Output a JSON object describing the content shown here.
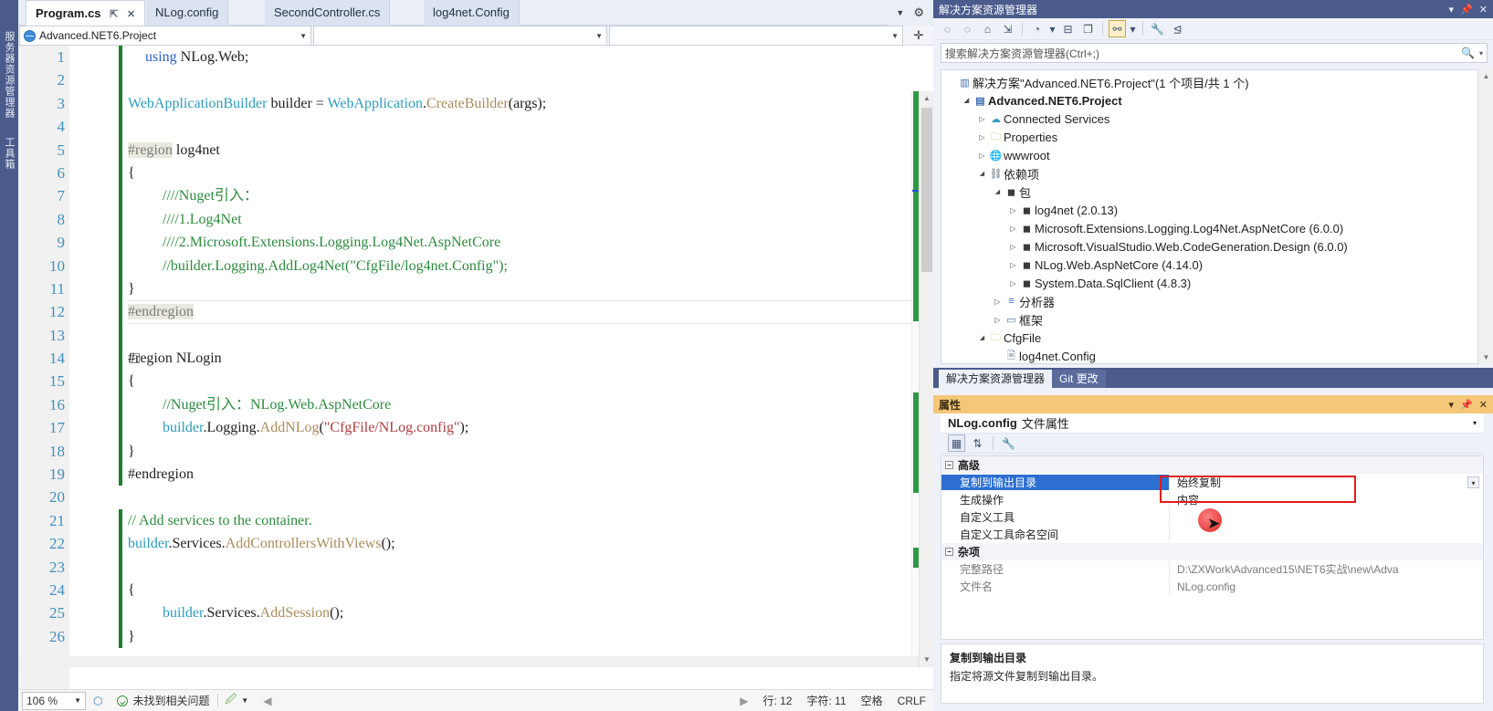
{
  "leftdock": {
    "tabs": [
      "服务器资源管理器",
      "工具箱"
    ]
  },
  "editor": {
    "tabs": [
      {
        "label": "Program.cs",
        "active": true,
        "pin": "⇱",
        "close": "✕"
      },
      {
        "label": "NLog.config",
        "active": false
      },
      {
        "label": "SecondController.cs",
        "active": false
      },
      {
        "label": "log4net.Config",
        "active": false
      }
    ],
    "tab_overflow_icon": "chevron-down",
    "tab_settings_icon": "gear",
    "navbar": {
      "project": "Advanced.NET6.Project",
      "type_dropdown": "",
      "member_dropdown": "",
      "split_icon": "✛"
    },
    "lines": [
      {
        "n": "1",
        "indent": 1,
        "parts": [
          {
            "t": "using ",
            "c": "kw"
          },
          {
            "t": "NLog.Web;",
            "c": "plain"
          }
        ]
      },
      {
        "n": "2",
        "indent": 0,
        "parts": []
      },
      {
        "n": "3",
        "indent": 0,
        "parts": [
          {
            "t": "WebApplicationBuilder",
            "c": "typ"
          },
          {
            "t": " builder = ",
            "c": "plain"
          },
          {
            "t": "WebApplication",
            "c": "typ"
          },
          {
            "t": ".",
            "c": "plain"
          },
          {
            "t": "CreateBuilder",
            "c": "mth"
          },
          {
            "t": "(args);",
            "c": "plain"
          }
        ]
      },
      {
        "n": "4",
        "indent": 0,
        "parts": []
      },
      {
        "n": "5",
        "indent": 0,
        "collapse": true,
        "parts": [
          {
            "t": "#region",
            "c": "pp"
          },
          {
            "t": " log4net",
            "c": "plain"
          }
        ]
      },
      {
        "n": "6",
        "indent": 0,
        "parts": [
          {
            "t": "{",
            "c": "plain"
          }
        ]
      },
      {
        "n": "7",
        "indent": 2,
        "parts": [
          {
            "t": "////Nuget引入：",
            "c": "cmt"
          }
        ]
      },
      {
        "n": "8",
        "indent": 2,
        "parts": [
          {
            "t": "////1.Log4Net",
            "c": "cmt"
          }
        ]
      },
      {
        "n": "9",
        "indent": 2,
        "parts": [
          {
            "t": "////2.Microsoft.Extensions.Logging.Log4Net.AspNetCore",
            "c": "cmt"
          }
        ]
      },
      {
        "n": "10",
        "indent": 2,
        "parts": [
          {
            "t": "//builder.Logging.AddLog4Net(\"CfgFile/log4net.Config\");",
            "c": "cmt"
          }
        ]
      },
      {
        "n": "11",
        "indent": 0,
        "parts": [
          {
            "t": "}",
            "c": "plain"
          }
        ]
      },
      {
        "n": "12",
        "indent": 0,
        "hl": true,
        "parts": [
          {
            "t": "#endregion",
            "c": "pp"
          }
        ]
      },
      {
        "n": "13",
        "indent": 0,
        "parts": []
      },
      {
        "n": "14",
        "indent": 0,
        "collapse": true,
        "parts": [
          {
            "t": "#region",
            "c": "plain"
          },
          {
            "t": " NLogin",
            "c": "plain"
          }
        ]
      },
      {
        "n": "15",
        "indent": 0,
        "parts": [
          {
            "t": "{",
            "c": "plain"
          }
        ]
      },
      {
        "n": "16",
        "indent": 2,
        "parts": [
          {
            "t": "//Nuget引入：NLog.Web.AspNetCore",
            "c": "cmt"
          }
        ]
      },
      {
        "n": "17",
        "indent": 2,
        "parts": [
          {
            "t": "builder",
            "c": "typ"
          },
          {
            "t": ".Logging.",
            "c": "plain"
          },
          {
            "t": "AddNLog",
            "c": "mth"
          },
          {
            "t": "(",
            "c": "plain"
          },
          {
            "t": "\"CfgFile/NLog.config\"",
            "c": "str"
          },
          {
            "t": ");",
            "c": "plain"
          }
        ]
      },
      {
        "n": "18",
        "indent": 0,
        "parts": [
          {
            "t": "}",
            "c": "plain"
          }
        ]
      },
      {
        "n": "19",
        "indent": 0,
        "parts": [
          {
            "t": "#endregion",
            "c": "plain"
          }
        ]
      },
      {
        "n": "20",
        "indent": 0,
        "parts": []
      },
      {
        "n": "21",
        "indent": 0,
        "parts": [
          {
            "t": "// Add services to the container.",
            "c": "cmt"
          }
        ]
      },
      {
        "n": "22",
        "indent": 0,
        "parts": [
          {
            "t": "builder",
            "c": "typ"
          },
          {
            "t": ".Services.",
            "c": "plain"
          },
          {
            "t": "AddControllersWithViews",
            "c": "mth"
          },
          {
            "t": "();",
            "c": "plain"
          }
        ]
      },
      {
        "n": "23",
        "indent": 0,
        "parts": []
      },
      {
        "n": "24",
        "indent": 0,
        "parts": [
          {
            "t": "{",
            "c": "plain"
          }
        ]
      },
      {
        "n": "25",
        "indent": 2,
        "parts": [
          {
            "t": "builder",
            "c": "typ"
          },
          {
            "t": ".Services.",
            "c": "plain"
          },
          {
            "t": "AddSession",
            "c": "mth"
          },
          {
            "t": "();",
            "c": "plain"
          }
        ]
      },
      {
        "n": "26",
        "indent": 0,
        "parts": [
          {
            "t": "}",
            "c": "plain"
          }
        ]
      }
    ],
    "statusbar": {
      "zoom": "106 %",
      "issues": "未找到相关问题",
      "line": "行: 12",
      "col": "字符: 11",
      "space": "空格",
      "eol": "CRLF"
    }
  },
  "solution_explorer": {
    "title": "解决方案资源管理器",
    "window_icons": {
      "dropdown": "▾",
      "pin": "📌",
      "close": "✕"
    },
    "toolbar": [
      "back-arrow",
      "forward-arrow",
      "home",
      "sync-with-active-document",
      "pending-changes-filter",
      "collapse-all",
      "show-all-files",
      "properties-view",
      "wrench",
      "preview-selected-items"
    ],
    "search_placeholder": "搜索解决方案资源管理器(Ctrl+;)",
    "tree": [
      {
        "depth": 0,
        "exp": "",
        "icon": "solution",
        "label": "解决方案\"Advanced.NET6.Project\"(1 个项目/共 1 个)",
        "bold": false
      },
      {
        "depth": 1,
        "exp": "▴",
        "icon": "project",
        "label": "Advanced.NET6.Project",
        "bold": true
      },
      {
        "depth": 2,
        "exp": "▸",
        "icon": "cloud",
        "label": "Connected Services",
        "bold": false
      },
      {
        "depth": 2,
        "exp": "▸",
        "icon": "wrenchfolder",
        "label": "Properties",
        "bold": false
      },
      {
        "depth": 2,
        "exp": "▸",
        "icon": "globe",
        "label": "wwwroot",
        "bold": false
      },
      {
        "depth": 2,
        "exp": "▴",
        "icon": "deps",
        "label": "依赖项",
        "bold": false
      },
      {
        "depth": 3,
        "exp": "▴",
        "icon": "package",
        "label": "包",
        "bold": false
      },
      {
        "depth": 4,
        "exp": "▸",
        "icon": "package",
        "label": "log4net (2.0.13)",
        "bold": false
      },
      {
        "depth": 4,
        "exp": "▸",
        "icon": "package",
        "label": "Microsoft.Extensions.Logging.Log4Net.AspNetCore (6.0.0)",
        "bold": false
      },
      {
        "depth": 4,
        "exp": "▸",
        "icon": "package",
        "label": "Microsoft.VisualStudio.Web.CodeGeneration.Design (6.0.0)",
        "bold": false
      },
      {
        "depth": 4,
        "exp": "▸",
        "icon": "package",
        "label": "NLog.Web.AspNetCore (4.14.0)",
        "bold": false
      },
      {
        "depth": 4,
        "exp": "▸",
        "icon": "package",
        "label": "System.Data.SqlClient (4.8.3)",
        "bold": false
      },
      {
        "depth": 3,
        "exp": "▸",
        "icon": "analyzer",
        "label": "分析器",
        "bold": false
      },
      {
        "depth": 3,
        "exp": "▸",
        "icon": "framework",
        "label": "框架",
        "bold": false
      },
      {
        "depth": 2,
        "exp": "▴",
        "icon": "folder",
        "label": "CfgFile",
        "bold": false
      },
      {
        "depth": 3,
        "exp": "",
        "icon": "configfile",
        "label": "log4net.Config",
        "bold": false
      }
    ],
    "bottom_tabs": [
      {
        "label": "解决方案资源管理器",
        "active": true
      },
      {
        "label": "Git 更改",
        "active": false
      }
    ]
  },
  "properties": {
    "title": "属性",
    "window_icons": {
      "dropdown": "▾",
      "pin": "📌",
      "close": "✕"
    },
    "object_name": "NLog.config",
    "object_kind": "文件属性",
    "header_dropdown": "▾",
    "toolbar": [
      "categorized-view",
      "alphabetical-view",
      "property-pages"
    ],
    "groups": [
      {
        "name": "高级",
        "rows": [
          {
            "key": "复制到输出目录",
            "value": "始终复制",
            "selected": true,
            "dim": false,
            "combo": true
          },
          {
            "key": "生成操作",
            "value": "内容",
            "selected": false,
            "dim": false,
            "combo": false
          },
          {
            "key": "自定义工具",
            "value": "",
            "selected": false,
            "dim": false,
            "combo": false
          },
          {
            "key": "自定义工具命名空间",
            "value": "",
            "selected": false,
            "dim": false,
            "combo": false
          }
        ]
      },
      {
        "name": "杂项",
        "rows": [
          {
            "key": "完整路径",
            "value": "D:\\ZXWork\\Advanced15\\NET6实战\\new\\Adva",
            "selected": false,
            "dim": true,
            "combo": false
          },
          {
            "key": "文件名",
            "value": "NLog.config",
            "selected": false,
            "dim": true,
            "combo": false
          }
        ]
      }
    ],
    "description": {
      "title": "复制到输出目录",
      "text": "指定将源文件复制到输出目录。"
    },
    "highlight_color": "#e01b1b",
    "selection_color": "#2d6fd1"
  }
}
